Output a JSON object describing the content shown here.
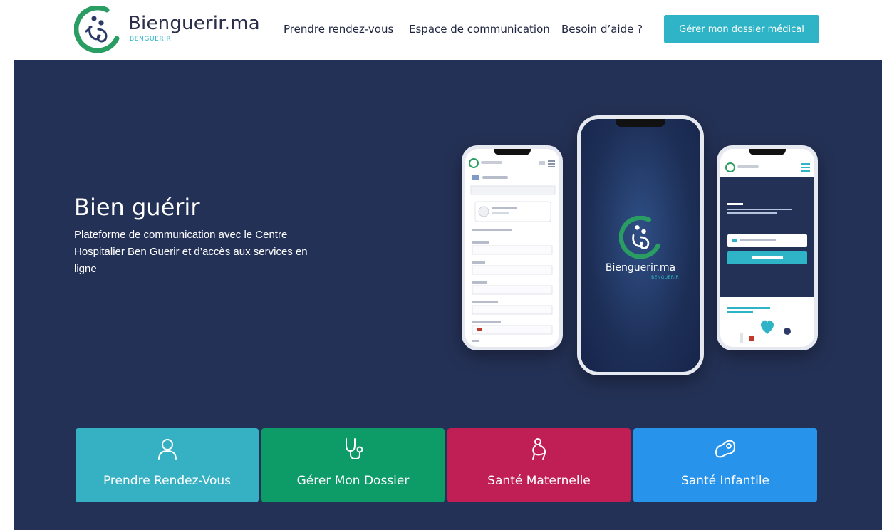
{
  "header": {
    "brand_name": "Bienguerir.ma",
    "brand_sub": "BENGUERIR",
    "nav": [
      {
        "label": "Prendre rendez-vous"
      },
      {
        "label": "Espace de communication"
      },
      {
        "label": "Besoin d’aide ?"
      }
    ],
    "cta_label": "Gérer mon dossier médical"
  },
  "hero": {
    "title": "Bien guérir",
    "description": "Plateforme de communication avec le Centre Hospitalier Ben Guerir et d’accès aux services en ligne",
    "center_phone": {
      "brand_name": "Bienguerir.ma",
      "brand_sub": "BENGUERIR"
    }
  },
  "services": [
    {
      "label": "Prendre Rendez-Vous",
      "icon": "user-icon",
      "color": "#36b1c4"
    },
    {
      "label": "Gérer Mon Dossier",
      "icon": "stethoscope-icon",
      "color": "#0d9b67"
    },
    {
      "label": "Santé Maternelle",
      "icon": "maternity-icon",
      "color": "#bf1f55"
    },
    {
      "label": "Santé Infantile",
      "icon": "baby-icon",
      "color": "#2793ea"
    }
  ],
  "colors": {
    "accent": "#2eb4c6",
    "hero_background": "#243156",
    "logo_green": "#2a9d62"
  }
}
